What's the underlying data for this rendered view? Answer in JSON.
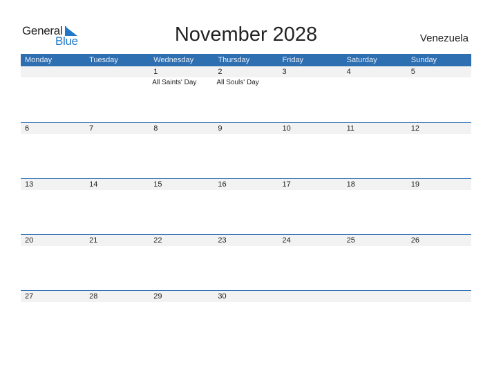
{
  "logo": {
    "general": "General",
    "blue": "Blue"
  },
  "title": "November 2028",
  "country": "Venezuela",
  "colors": {
    "header_bg": "#2e6fb2",
    "strip_bg": "#f2f2f2",
    "brand_blue": "#1f78c8"
  },
  "weekdays": [
    "Monday",
    "Tuesday",
    "Wednesday",
    "Thursday",
    "Friday",
    "Saturday",
    "Sunday"
  ],
  "weeks": [
    [
      {
        "day": "",
        "holiday": ""
      },
      {
        "day": "",
        "holiday": ""
      },
      {
        "day": "1",
        "holiday": "All Saints' Day"
      },
      {
        "day": "2",
        "holiday": "All Souls' Day"
      },
      {
        "day": "3",
        "holiday": ""
      },
      {
        "day": "4",
        "holiday": ""
      },
      {
        "day": "5",
        "holiday": ""
      }
    ],
    [
      {
        "day": "6",
        "holiday": ""
      },
      {
        "day": "7",
        "holiday": ""
      },
      {
        "day": "8",
        "holiday": ""
      },
      {
        "day": "9",
        "holiday": ""
      },
      {
        "day": "10",
        "holiday": ""
      },
      {
        "day": "11",
        "holiday": ""
      },
      {
        "day": "12",
        "holiday": ""
      }
    ],
    [
      {
        "day": "13",
        "holiday": ""
      },
      {
        "day": "14",
        "holiday": ""
      },
      {
        "day": "15",
        "holiday": ""
      },
      {
        "day": "16",
        "holiday": ""
      },
      {
        "day": "17",
        "holiday": ""
      },
      {
        "day": "18",
        "holiday": ""
      },
      {
        "day": "19",
        "holiday": ""
      }
    ],
    [
      {
        "day": "20",
        "holiday": ""
      },
      {
        "day": "21",
        "holiday": ""
      },
      {
        "day": "22",
        "holiday": ""
      },
      {
        "day": "23",
        "holiday": ""
      },
      {
        "day": "24",
        "holiday": ""
      },
      {
        "day": "25",
        "holiday": ""
      },
      {
        "day": "26",
        "holiday": ""
      }
    ],
    [
      {
        "day": "27",
        "holiday": ""
      },
      {
        "day": "28",
        "holiday": ""
      },
      {
        "day": "29",
        "holiday": ""
      },
      {
        "day": "30",
        "holiday": ""
      },
      {
        "day": "",
        "holiday": ""
      },
      {
        "day": "",
        "holiday": ""
      },
      {
        "day": "",
        "holiday": ""
      }
    ]
  ]
}
